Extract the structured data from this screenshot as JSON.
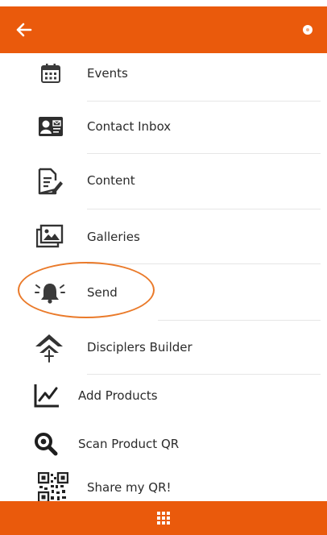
{
  "header": {
    "back_icon": "arrow-left-icon",
    "right_icon": "dot-icon",
    "background": "#ea5a0c"
  },
  "menu": {
    "items": [
      {
        "label": "Events",
        "icon": "calendar-icon"
      },
      {
        "label": "Contact Inbox",
        "icon": "contact-card-icon"
      },
      {
        "label": "Content",
        "icon": "document-edit-icon"
      },
      {
        "label": "Galleries",
        "icon": "gallery-icon"
      },
      {
        "label": "Send",
        "icon": "bell-alert-icon"
      },
      {
        "label": "Disciplers Builder",
        "icon": "disciplers-icon"
      },
      {
        "label": "Add Products",
        "icon": "line-chart-icon"
      },
      {
        "label": "Scan Product QR",
        "icon": "magnifier-icon"
      },
      {
        "label": "Share my QR!",
        "icon": "qr-code-icon"
      }
    ],
    "highlighted": "Send"
  },
  "footer": {
    "icon": "grid-icon",
    "background": "#ea5a0c"
  }
}
